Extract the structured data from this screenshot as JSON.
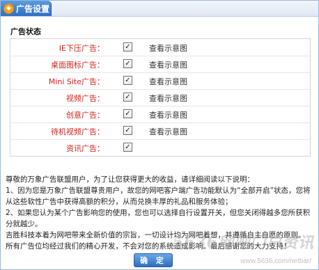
{
  "window": {
    "title": "广告设置"
  },
  "section": {
    "title": "广告状态"
  },
  "ad_rows": [
    {
      "label": "IE下压广告：",
      "checked": true,
      "link": "查看示意图"
    },
    {
      "label": "桌面图标广告：",
      "checked": true,
      "link": "查看示意图"
    },
    {
      "label": "Mini Site广告：",
      "checked": true,
      "link": "查看示意图"
    },
    {
      "label": "视频广告：",
      "checked": true,
      "link": "查看示意图"
    },
    {
      "label": "创意广告：",
      "checked": true,
      "link": "查看示意图"
    },
    {
      "label": "待机视频广告：",
      "checked": true,
      "link": "查看示意图"
    },
    {
      "label": "资讯广告：",
      "checked": true,
      "link": ""
    }
  ],
  "description": {
    "p1": "尊敬的万象广告联盟用户，为了让您获得更大的收益，请详细阅读以下说明：",
    "p2": "1、因为您是万象广告联盟尊贵用户，故您的网吧客户端广告功能默认为“全部开启”状态，您将从这些软性广告中获得高额的积分，从而兑换丰厚的礼品和服务体验；",
    "p3": "2、如果您认为某个广告影响您的使用，您也可以选择自行设置开关，但您关闭得越多您所获积分就越少。",
    "p4": "吉胜科技本着为网吧带来全新价值的宗旨，一切设计均为网吧着想，并遵循自主自愿的原则。所有广告位均经过我们的精心开发，不会对您的系统造成影响。最后感谢您的大力支持！"
  },
  "buttons": {
    "ok": "确 定"
  },
  "watermark": {
    "main": "5636网吧门户资讯",
    "sub": "www.5636.com/netbar/"
  },
  "colors": {
    "title_bar": "#2f6fc4",
    "label_red": "#d0241b",
    "border": "#d5d5d5"
  }
}
